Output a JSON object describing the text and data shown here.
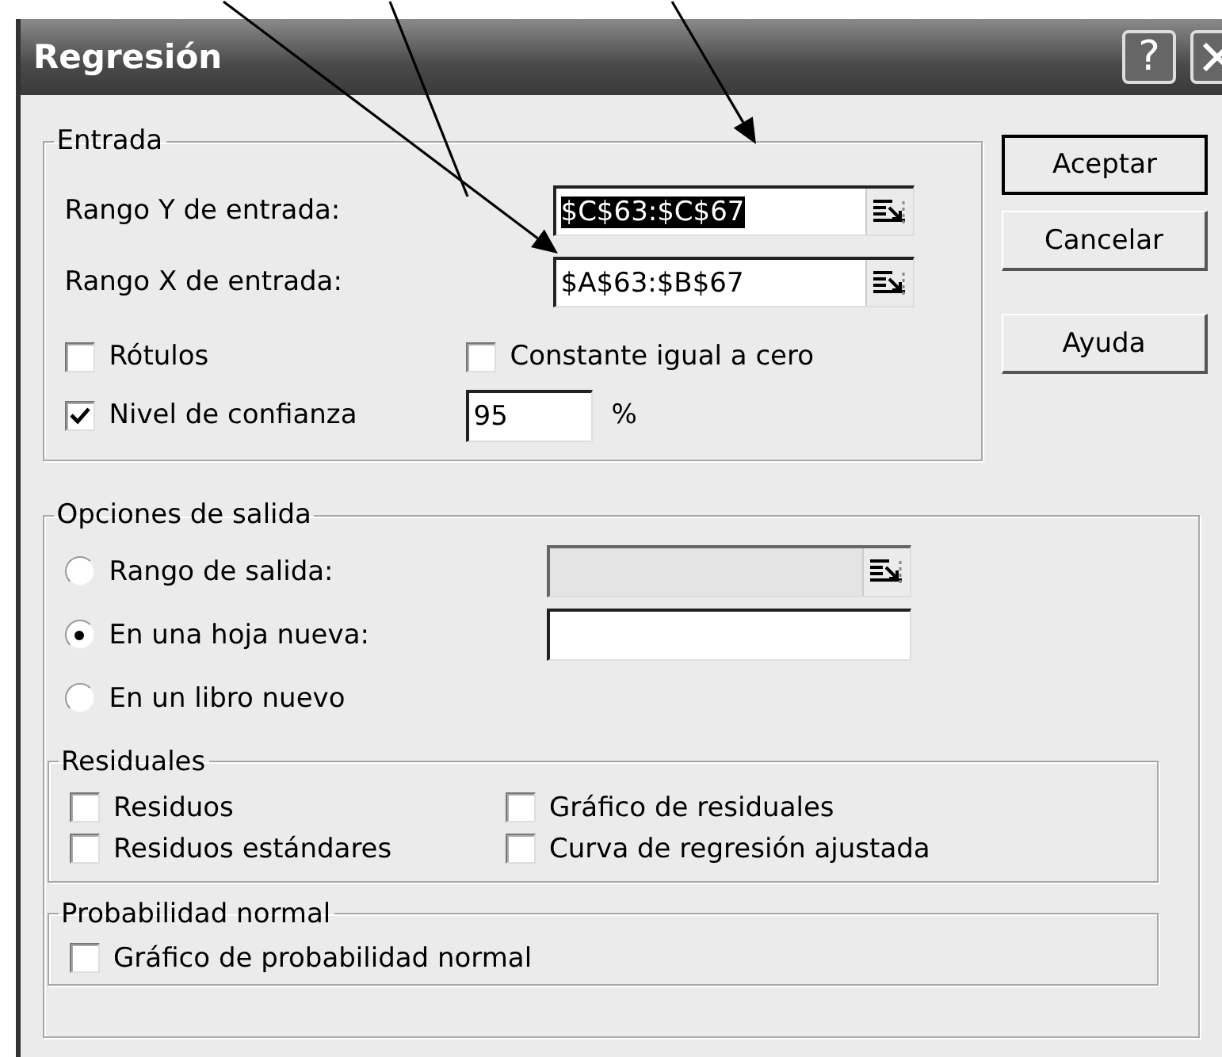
{
  "window": {
    "title": "Regresión",
    "help_button": "?"
  },
  "input": {
    "title": "Entrada",
    "fields": [
      {
        "label": "Rango Y de entrada:",
        "value": "$C$63:$C$67",
        "selected": true
      },
      {
        "label": "Rango X de entrada:",
        "value": "$A$63:$B$67",
        "selected": false
      }
    ],
    "checkboxes": [
      {
        "label": "Rótulos",
        "checked": false
      },
      {
        "label": "Constante igual a cero",
        "checked": false
      },
      {
        "label": "Nivel de confianza",
        "checked": true
      }
    ],
    "confidence": {
      "value": "95",
      "unit": "%"
    }
  },
  "buttons": [
    "Aceptar",
    "Cancelar",
    "Ayuda"
  ],
  "output": {
    "title": "Opciones de salida",
    "options": [
      {
        "label": "Rango de salida:",
        "selected": false,
        "kind": "range",
        "field_disabled": true
      },
      {
        "label": "En una hoja nueva:",
        "selected": true,
        "kind": "text",
        "field_disabled": false
      },
      {
        "label": "En un libro nuevo",
        "selected": false,
        "kind": "plain"
      }
    ],
    "residuals": {
      "title": "Residuales",
      "checkboxes": [
        {
          "label": "Residuos",
          "checked": false
        },
        {
          "label": "Gráfico de residuales",
          "checked": false
        },
        {
          "label": "Residuos estándares",
          "checked": false
        },
        {
          "label": "Curva de regresión ajustada",
          "checked": false
        }
      ]
    },
    "normal_probability": {
      "title": "Probabilidad normal",
      "checkboxes": [
        {
          "label": "Gráfico de probabilidad normal",
          "checked": false
        }
      ]
    }
  }
}
